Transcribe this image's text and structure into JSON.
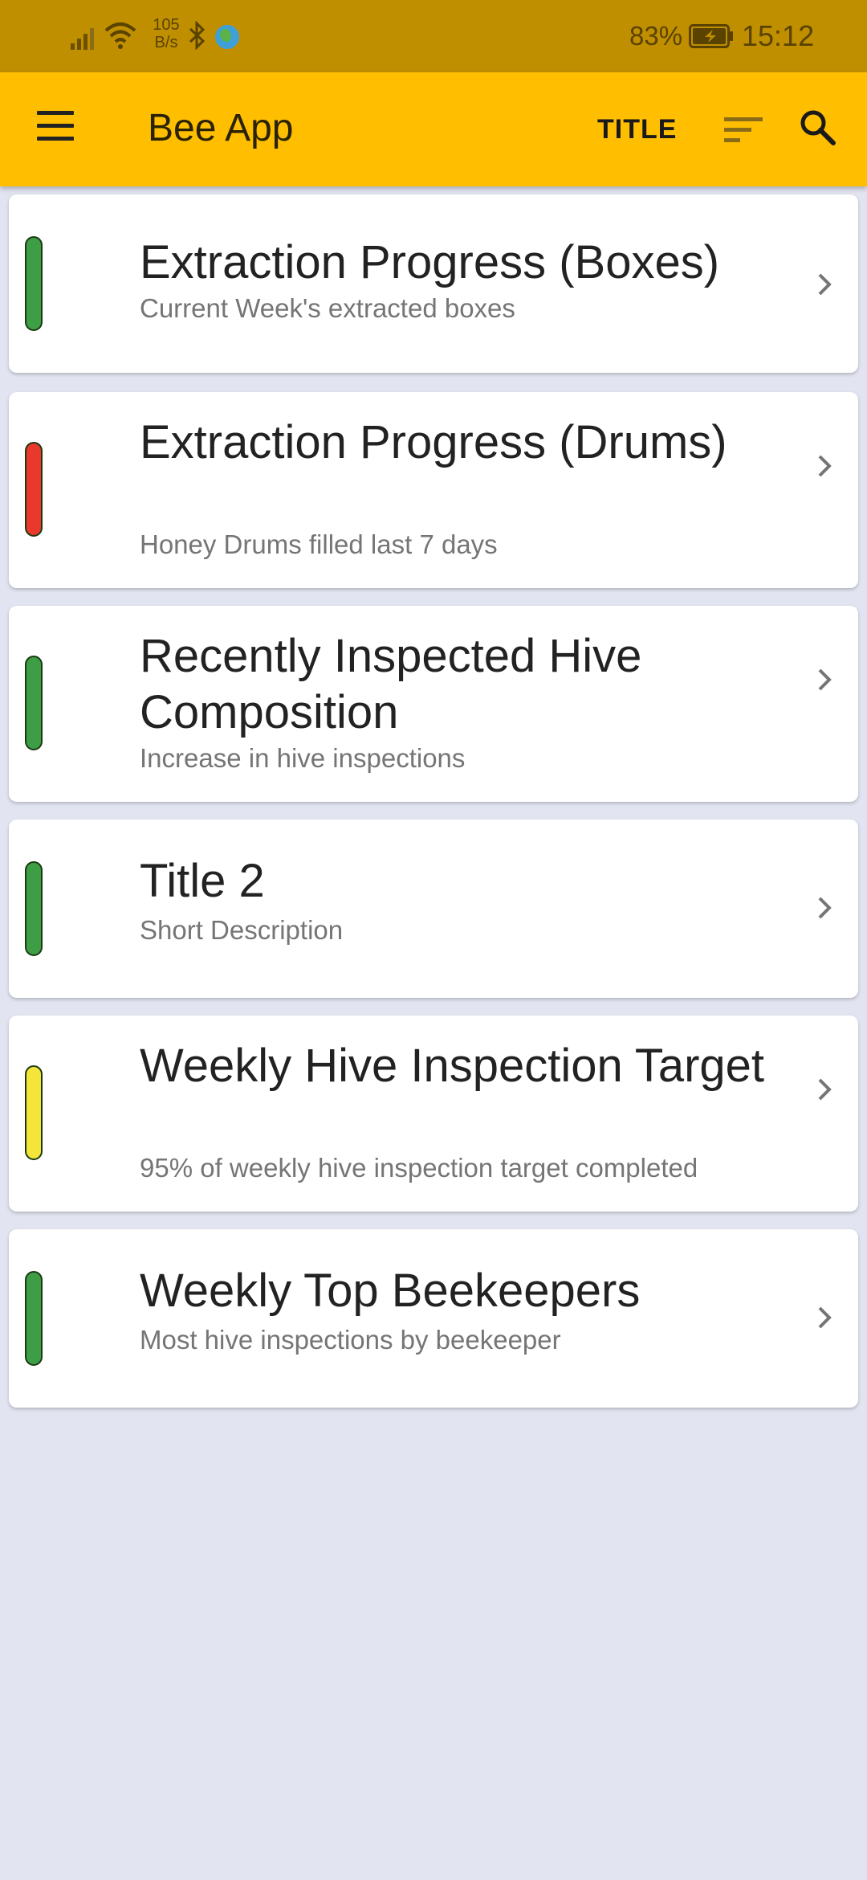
{
  "status_bar": {
    "net_speed_value": "105",
    "net_speed_unit": "B/s",
    "battery_percent": "83%",
    "time": "15:12",
    "icons": [
      "signal-icon",
      "wifi-icon",
      "bluetooth-icon",
      "globe-icon",
      "battery-charging-icon"
    ]
  },
  "app_bar": {
    "title": "Bee App",
    "action_label": "TITLE",
    "icons": [
      "menu-icon",
      "sort-icon",
      "search-icon"
    ]
  },
  "colors": {
    "status_bar": "#bf8f00",
    "app_bar": "#ffbf00",
    "background": "#e2e5f1",
    "green": "#3e9e45",
    "red": "#e9382c",
    "yellow": "#f5e53a"
  },
  "cards": [
    {
      "title": "Extraction Progress (Boxes)",
      "description": "Current Week's extracted boxes",
      "status": "green"
    },
    {
      "title": "Extraction Progress (Drums)",
      "description": "Honey Drums filled last 7 days",
      "status": "red"
    },
    {
      "title": "Recently Inspected Hive Composition",
      "description": "Increase in hive inspections",
      "status": "green"
    },
    {
      "title": "Title 2",
      "description": "Short Description",
      "status": "green"
    },
    {
      "title": "Weekly Hive Inspection Target",
      "description": "95% of weekly hive inspection target completed",
      "status": "yellow"
    },
    {
      "title": "Weekly Top Beekeepers",
      "description": "Most hive inspections by beekeeper",
      "status": "green"
    }
  ]
}
